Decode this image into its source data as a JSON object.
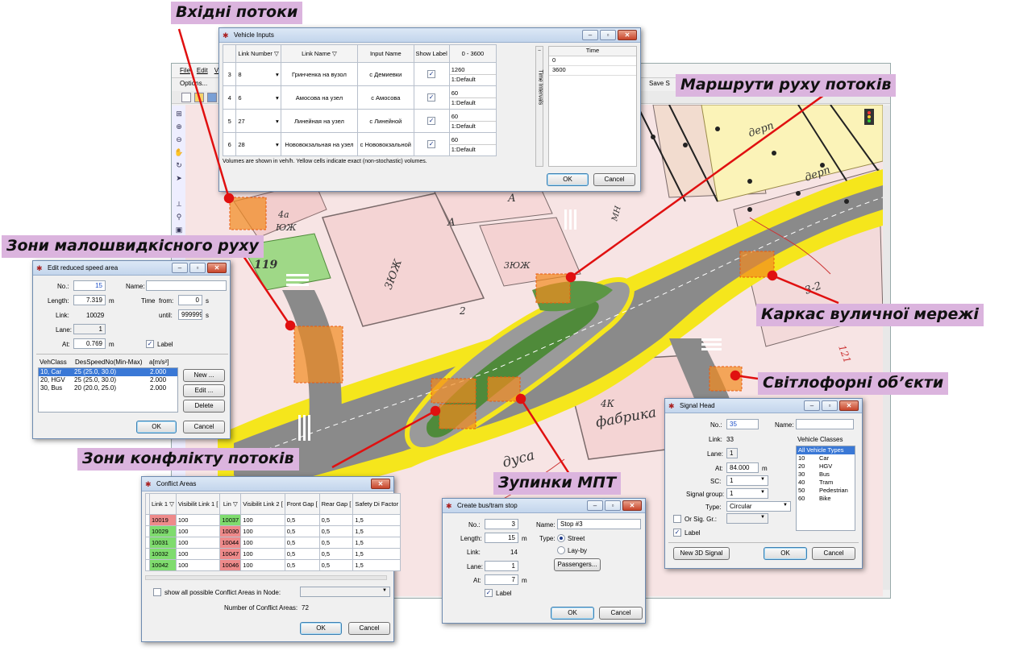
{
  "app": {
    "menu": [
      "File",
      "Edit",
      "V"
    ],
    "options": "Options...",
    "save": "Save S"
  },
  "annotations": {
    "inputs": "Вхідні потоки",
    "routes": "Маршрути руху потоків",
    "reduced": "Зони малошвидкісного руху",
    "network": "Каркас вуличної мережі",
    "signals": "Світлофорні об’єкти",
    "conflict": "Зони конфлікту потоків",
    "stops": "Зупинки МПТ"
  },
  "map_labels": {
    "a1": "4а",
    "yuzh": "ЮЖ",
    "n119": "119",
    "l3yuzh": "3ЮЖ",
    "n2": "2",
    "yuzh2": "3ЮЖ",
    "a": "А",
    "a2": "А",
    "yuzh3": "3ЮЖ",
    "mn": "МН",
    "derp1": "дерп",
    "derp2": "дерп",
    "n32": "3-2",
    "n121": "121",
    "k4": "4К",
    "fabrika": "фабрика",
    "dusa": "дуса"
  },
  "vehicle_inputs": {
    "title": "Vehicle Inputs",
    "headers": {
      "no": "",
      "link": "Link Number",
      "name": "Link Name",
      "input": "Input Name",
      "show": "Show Label",
      "range": "0 - 3600"
    },
    "rows": [
      {
        "no": "3",
        "link": "8",
        "name": "Гринченка на вузол",
        "input": "с Демиевки",
        "v1": "1260",
        "v2": "1:Default"
      },
      {
        "no": "4",
        "link": "6",
        "name": "Амосова на узел",
        "input": "с Амосова",
        "v1": "60",
        "v2": "1:Default"
      },
      {
        "no": "5",
        "link": "27",
        "name": "Линейная на узел",
        "input": "с Линейной",
        "v1": "60",
        "v2": "1:Default"
      },
      {
        "no": "6",
        "link": "28",
        "name": "Нововокзальная на узел",
        "input": "с Нововокзальной",
        "v1": "60",
        "v2": "1:Default"
      }
    ],
    "side_label": "Time Intervals",
    "time_header": "Time",
    "times": [
      "0",
      "3600"
    ],
    "note": "Volumes are shown in veh/h. Yellow cells indicate exact (non-stochastic) volumes.",
    "ok": "OK",
    "cancel": "Cancel"
  },
  "reduced_speed": {
    "title": "Edit reduced speed area",
    "no_label": "No.:",
    "no_value": "15",
    "name_label": "Name:",
    "name_value": "",
    "length_label": "Length:",
    "length_value": "7.319",
    "length_unit": "m",
    "time_label": "Time",
    "from_label": "from:",
    "from_value": "0",
    "from_unit": "s",
    "link_label": "Link:",
    "link_value": "10029",
    "until_label": "until:",
    "until_value": "999999",
    "until_unit": "s",
    "lane_label": "Lane:",
    "lane_value": "1",
    "at_label": "At:",
    "at_value": "0.769",
    "at_unit": "m",
    "label_chk": "Label",
    "col1": "VehClass",
    "col2": "DesSpeedNo(Min-Max)",
    "col3": "a[m/s²]",
    "rows": [
      {
        "c": "10, Car",
        "s": "25 (25.0, 30.0)",
        "a": "2.000"
      },
      {
        "c": "20, HGV",
        "s": "25 (25.0, 30.0)",
        "a": "2.000"
      },
      {
        "c": "30, Bus",
        "s": "20 (20.0, 25.0)",
        "a": "2.000"
      }
    ],
    "new": "New ...",
    "edit": "Edit ...",
    "delete": "Delete",
    "ok": "OK",
    "cancel": "Cancel"
  },
  "conflict": {
    "title": "Conflict Areas",
    "h_link1": "Link 1",
    "h_vis1": "Visibilit Link 1 [",
    "h_lin": "Lin",
    "h_vis2": "Visibilit Link 2 [",
    "h_front": "Front Gap [",
    "h_rear": "Rear Gap [",
    "h_safety": "Safety Di Factor",
    "rows": [
      {
        "l1": "10019",
        "v1": "100",
        "l2": "10037",
        "v2": "100",
        "f": "0,5",
        "r": "0,5",
        "s": "1,5",
        "c1": "#ee8a8a",
        "c2": "#7fdc6e"
      },
      {
        "l1": "10029",
        "v1": "100",
        "l2": "10030",
        "v2": "100",
        "f": "0,5",
        "r": "0,5",
        "s": "1,5",
        "c1": "#7fdc6e",
        "c2": "#ee8a8a"
      },
      {
        "l1": "10031",
        "v1": "100",
        "l2": "10044",
        "v2": "100",
        "f": "0,5",
        "r": "0,5",
        "s": "1,5",
        "c1": "#7fdc6e",
        "c2": "#ee8a8a"
      },
      {
        "l1": "10032",
        "v1": "100",
        "l2": "10047",
        "v2": "100",
        "f": "0,5",
        "r": "0,5",
        "s": "1,5",
        "c1": "#7fdc6e",
        "c2": "#ee8a8a"
      },
      {
        "l1": "10042",
        "v1": "100",
        "l2": "10046",
        "v2": "100",
        "f": "0,5",
        "r": "0,5",
        "s": "1,5",
        "c1": "#7fdc6e",
        "c2": "#ee8a8a"
      }
    ],
    "show_all": "show all possible Conflict Areas in Node:",
    "num_label": "Number of Conflict Areas:",
    "num_value": "72",
    "ok": "OK",
    "cancel": "Cancel"
  },
  "stop": {
    "title": "Create bus/tram stop",
    "no_label": "No.:",
    "no_value": "3",
    "name_label": "Name:",
    "name_value": "Stop #3",
    "length_label": "Length:",
    "length_value": "15",
    "length_unit": "m",
    "type_label": "Type:",
    "type_street": "Street",
    "type_layby": "Lay-by",
    "link_label": "Link:",
    "link_value": "14",
    "lane_label": "Lane:",
    "lane_value": "1",
    "at_label": "At:",
    "at_value": "7",
    "at_unit": "m",
    "passengers": "Passengers...",
    "label_chk": "Label",
    "ok": "OK",
    "cancel": "Cancel"
  },
  "signal": {
    "title": "Signal Head",
    "no_label": "No.:",
    "no_value": "35",
    "name_label": "Name:",
    "name_value": "",
    "link_label": "Link:",
    "link_value": "33",
    "classes_label": "Vehicle Classes",
    "lane_label": "Lane:",
    "lane_value": "1",
    "at_label": "At:",
    "at_value": "84.000",
    "at_unit": "m",
    "sc_label": "SC:",
    "sc_value": "1",
    "group_label": "Signal group:",
    "group_value": "1",
    "type_label": "Type:",
    "type_value": "Circular",
    "or_label": "Or Sig. Gr.:",
    "label_chk": "Label",
    "classes": [
      {
        "n": "All Vehicle Types",
        "t": ""
      },
      {
        "n": "10",
        "t": "Car"
      },
      {
        "n": "20",
        "t": "HGV"
      },
      {
        "n": "30",
        "t": "Bus"
      },
      {
        "n": "40",
        "t": "Tram"
      },
      {
        "n": "50",
        "t": "Pedestrian"
      },
      {
        "n": "60",
        "t": "Bike"
      }
    ],
    "new3d": "New 3D Signal",
    "ok": "OK",
    "cancel": "Cancel"
  },
  "colors": {
    "annotation_bg": "#dbb4de",
    "leader_line": "#e01010",
    "road_yellow": "#f5e61c",
    "road_grey": "#8a8a8a",
    "grass": "#4f8a3a"
  }
}
